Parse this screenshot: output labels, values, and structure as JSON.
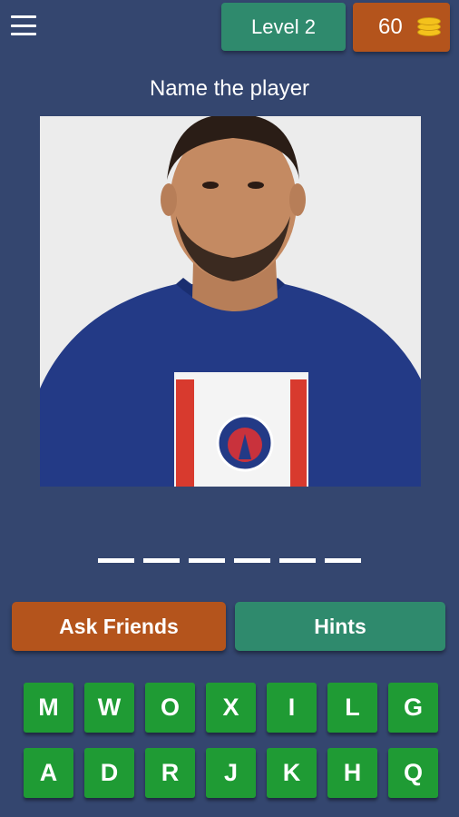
{
  "header": {
    "level_label": "Level 2",
    "coins": "60"
  },
  "question": {
    "title": "Name the player"
  },
  "photo": {
    "subject": "player-photo"
  },
  "answer": {
    "slots": 6
  },
  "actions": {
    "ask_friends": "Ask Friends",
    "hints": "Hints"
  },
  "keyboard": {
    "keys": [
      "M",
      "W",
      "O",
      "X",
      "I",
      "L",
      "G",
      "A",
      "D",
      "R",
      "J",
      "K",
      "H",
      "Q"
    ]
  },
  "colors": {
    "background": "#34466f",
    "green_button": "#2f8a6d",
    "orange_button": "#b4541c",
    "key_green": "#1f9b34"
  }
}
